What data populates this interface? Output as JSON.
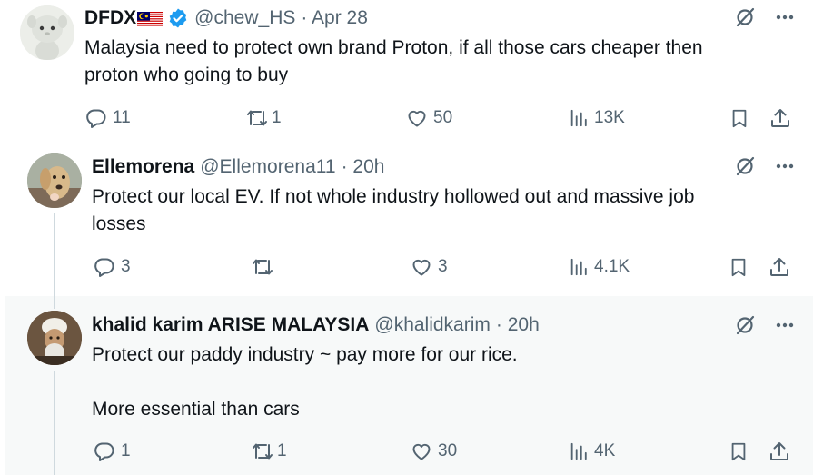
{
  "tweets": [
    {
      "name": "DFDX",
      "handle": "@chew_HS",
      "time": "· Apr 28",
      "text": "Malaysia need to protect own brand Proton, if all those cars cheaper then\nproton who going to buy",
      "replies": "11",
      "retweets": "1",
      "likes": "50",
      "views": "13K",
      "has_flag": true,
      "verified": true
    },
    {
      "name": "Ellemorena",
      "handle": "@Ellemorena11",
      "time": "· 20h",
      "text": "Protect our local EV. If not whole industry hollowed out and massive job\nlosses",
      "replies": "3",
      "retweets": "",
      "likes": "3",
      "views": "4.1K"
    },
    {
      "name": "khalid karim ARISE MALAYSIA",
      "handle": "@khalidkarim",
      "time": "· 20h",
      "text": "Protect our paddy industry ~ pay more for our rice.\n\nMore essential than cars",
      "replies": "1",
      "retweets": "1",
      "likes": "30",
      "views": "4K"
    }
  ],
  "colors": {
    "text": "#0f1419",
    "muted": "#536471",
    "verified": "#1d9bf0",
    "thread_line": "#cfd9de",
    "highlight_bg": "#f7f9f9"
  },
  "icons": [
    "grok-icon",
    "more-icon",
    "reply-icon",
    "retweet-icon",
    "like-icon",
    "views-icon",
    "bookmark-icon",
    "share-icon"
  ]
}
